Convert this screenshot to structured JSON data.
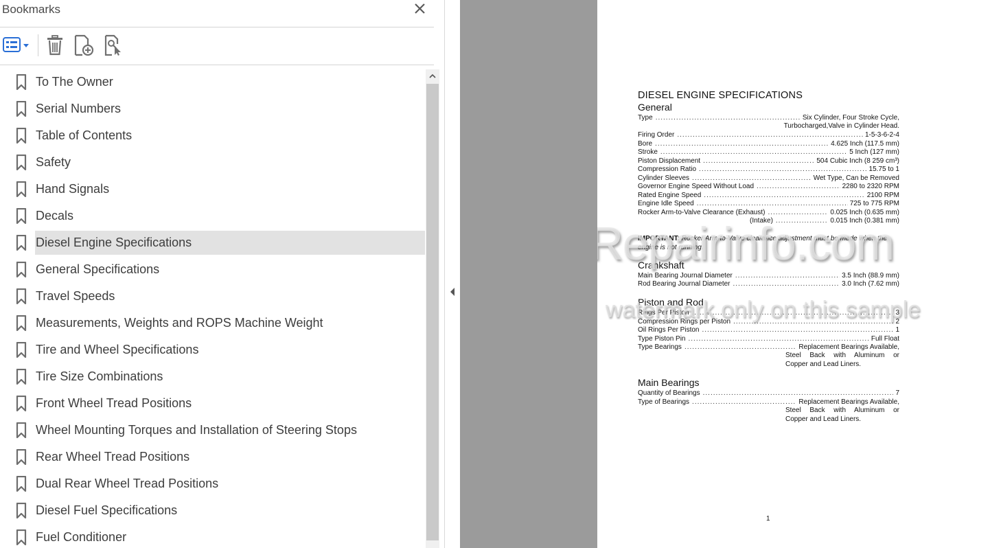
{
  "panel": {
    "title": "Bookmarks",
    "toolbar": {
      "options_icon": "options-list-icon",
      "delete_icon": "trash-icon",
      "new_bookmark_icon": "new-bookmark-icon",
      "find_bookmark_icon": "find-bookmark-icon"
    },
    "bookmarks": [
      {
        "label": "To The Owner"
      },
      {
        "label": "Serial Numbers"
      },
      {
        "label": "Table of Contents"
      },
      {
        "label": "Safety"
      },
      {
        "label": "Hand Signals"
      },
      {
        "label": "Decals"
      },
      {
        "label": "Diesel Engine Specifications",
        "selected": true
      },
      {
        "label": "General Specifications"
      },
      {
        "label": "Travel Speeds"
      },
      {
        "label": "Measurements, Weights and ROPS Machine Weight"
      },
      {
        "label": "Tire and Wheel Specifications"
      },
      {
        "label": "Tire Size Combinations"
      },
      {
        "label": "Front Wheel Tread Positions"
      },
      {
        "label": "Wheel Mounting Torques and Installation of Steering Stops"
      },
      {
        "label": "Rear Wheel Tread Positions"
      },
      {
        "label": "Dual Rear Wheel Tread Positions"
      },
      {
        "label": "Diesel Fuel Specifications"
      },
      {
        "label": "Fuel Conditioner"
      }
    ]
  },
  "document": {
    "title": "DIESEL ENGINE SPECIFICATIONS",
    "general": {
      "heading": "General",
      "type_key": "Type",
      "type_val": "Six Cylinder, Four Stroke Cycle,",
      "type_cont": "Turbocharged,Valve in Cylinder Head.",
      "firing_key": "Firing Order",
      "firing_val": "1-5-3-6-2-4",
      "bore_key": "Bore",
      "bore_val": "4.625 Inch (117.5 mm)",
      "stroke_key": "Stroke",
      "stroke_val": "5 Inch (127 mm)",
      "disp_key": "Piston Displacement",
      "disp_val": "504 Cubic Inch (8 259 cm³)",
      "comp_key": "Compression Ratio",
      "comp_val": "15.75 to 1",
      "sleeves_key": "Cylinder Sleeves",
      "sleeves_val": "Wet Type, Can be Removed",
      "gov_key": "Governor Engine Speed Without Load",
      "gov_val": "2280 to 2320 RPM",
      "rated_key": "Rated Engine Speed",
      "rated_val": "2100 RPM",
      "idle_key": "Engine Idle Speed",
      "idle_val": "725 to 775 RPM",
      "rocker_key": "Rocker Arm-to-Valve Clearance (Exhaust)",
      "rocker_val": "0.025 Inch (0.635 mm)",
      "intake_key": "(Intake)",
      "intake_val": "0.015 Inch (0.381 mm)"
    },
    "important": {
      "label": "IMPORTANT:",
      "text": "Rocker Arm-to-Valve clearance adjustment must be made when the engine is not running."
    },
    "crankshaft": {
      "heading": "Crankshaft",
      "main_key": "Main Bearing Journal Diameter",
      "main_val": "3.5 Inch (88.9 mm)",
      "rod_key": "Rod Bearing Journal Diameter",
      "rod_val": "3.0 Inch (7.62 mm)"
    },
    "piston": {
      "heading": "Piston and Rod",
      "rings_key": "Rings Per Piston",
      "rings_val": "3",
      "comp_key": "Compression Rings per Piston",
      "comp_val": "2",
      "oil_key": "Oil Rings Per Piston",
      "oil_val": "1",
      "pin_key": "Type Piston Pin",
      "pin_val": "Full Float",
      "bear_key": "Type Bearings",
      "bear_val": "Replacement Bearings Available,",
      "bear_cont1": "Steel Back with Aluminum or",
      "bear_cont2": "Copper and Lead Liners."
    },
    "main_bearings": {
      "heading": "Main Bearings",
      "qty_key": "Quantity of Bearings",
      "qty_val": "7",
      "type_key": "Type of Bearings",
      "type_val": "Replacement Bearings Available,",
      "type_cont1": "Steel Back with Aluminum or",
      "type_cont2": "Copper and Lead Liners."
    },
    "page_number": "1",
    "watermark": {
      "brand": "eRepairinfo.com",
      "note": "watermark only on this sample"
    }
  }
}
